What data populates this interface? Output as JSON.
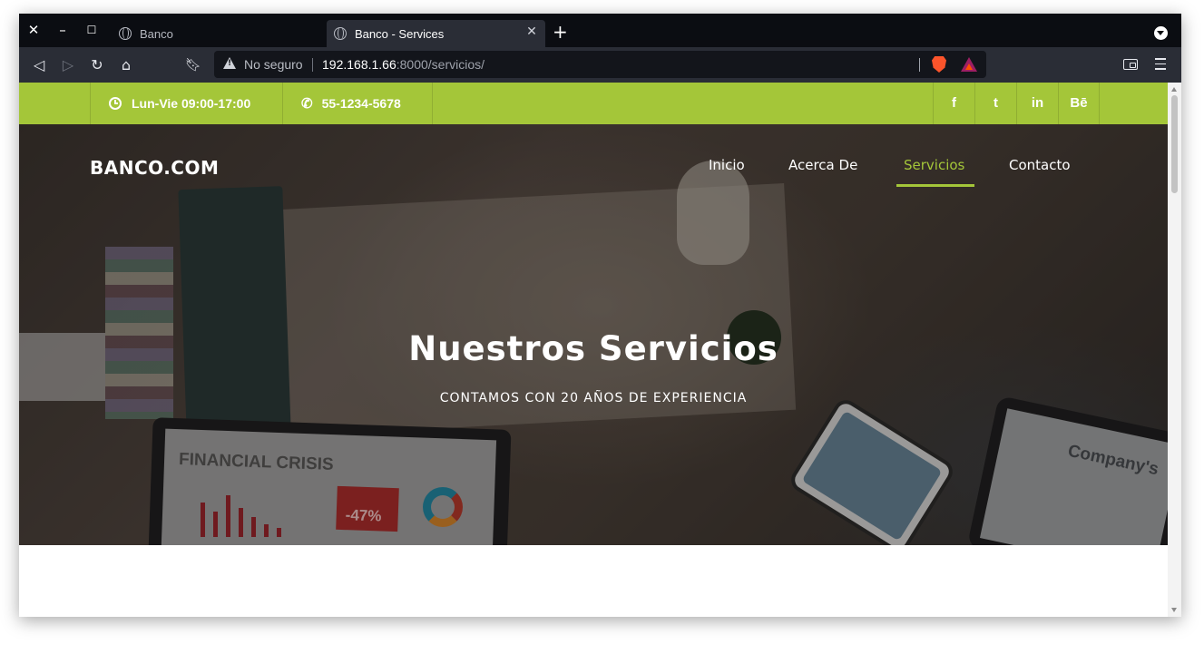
{
  "browser": {
    "tabs": [
      {
        "title": "Banco",
        "active": false
      },
      {
        "title": "Banco - Services",
        "active": true
      }
    ],
    "address": {
      "security_label": "No seguro",
      "host": "192.168.1.66",
      "path": ":8000/servicios/"
    },
    "colors": {
      "chrome_dark": "#0b0d12",
      "toolbar": "#2a2d36",
      "brave_orange": "#fb542b"
    }
  },
  "site": {
    "topbar": {
      "hours": "Lun-Vie 09:00-17:00",
      "phone": "55-1234-5678",
      "social": [
        "f",
        "t",
        "in",
        "Bē"
      ],
      "social_icons": [
        "facebook-icon",
        "twitter-icon",
        "linkedin-icon",
        "behance-icon"
      ]
    },
    "logo": "BANCO.COM",
    "nav": [
      {
        "label": "Inicio",
        "active": false
      },
      {
        "label": "Acerca De",
        "active": false
      },
      {
        "label": "Servicios",
        "active": true
      },
      {
        "label": "Contacto",
        "active": false
      }
    ],
    "hero": {
      "title": "Nuestros Servicios",
      "subtitle": "CONTAMOS CON 20 AÑOS DE EXPERIENCIA",
      "image_text": {
        "laptop": "FINANCIAL CRISIS",
        "badge": "-47%",
        "tablet": "Company's"
      }
    },
    "colors": {
      "accent": "#a4c639",
      "white": "#ffffff"
    }
  }
}
